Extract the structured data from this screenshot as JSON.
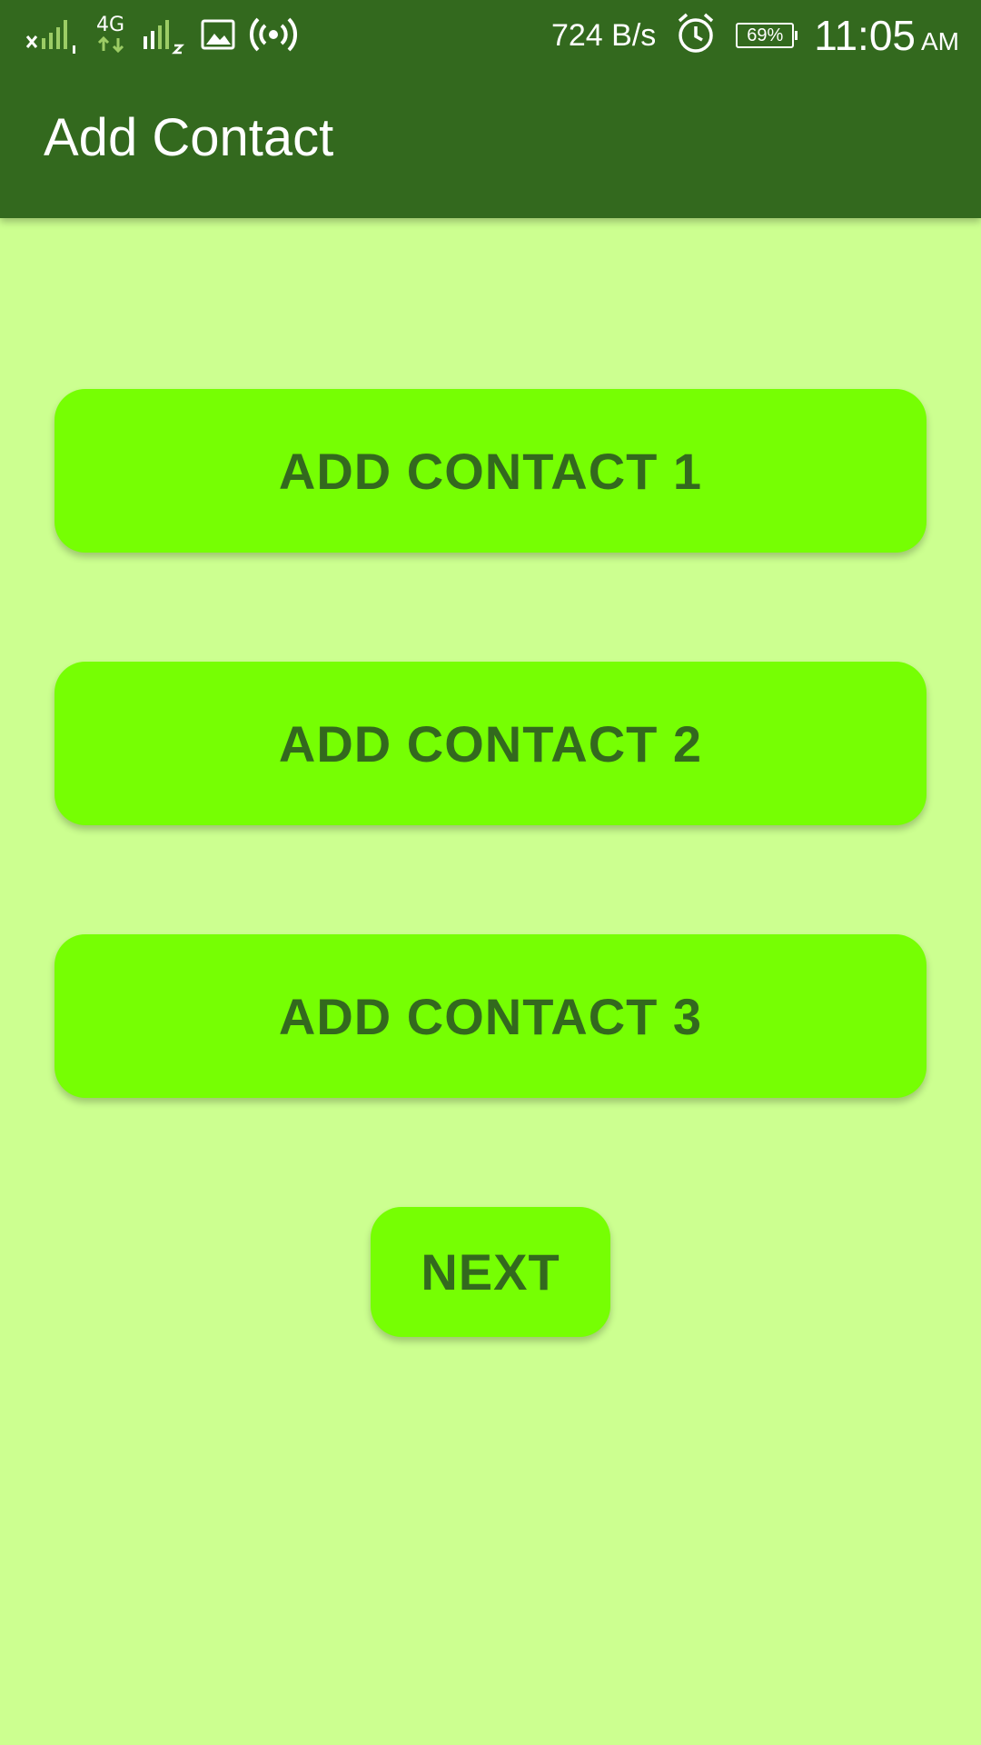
{
  "status_bar": {
    "network_speed": "724 B/s",
    "battery_percent": "69%",
    "time": "11:05",
    "am_pm": "AM",
    "network_type": "4G"
  },
  "app_bar": {
    "title": "Add Contact"
  },
  "buttons": {
    "add_contact_1": "ADD CONTACT 1",
    "add_contact_2": "ADD CONTACT 2",
    "add_contact_3": "ADD CONTACT 3",
    "next": "NEXT"
  },
  "colors": {
    "app_bar": "#33691e",
    "background": "#ccff90",
    "button": "#76ff03",
    "button_text": "#33691e"
  }
}
